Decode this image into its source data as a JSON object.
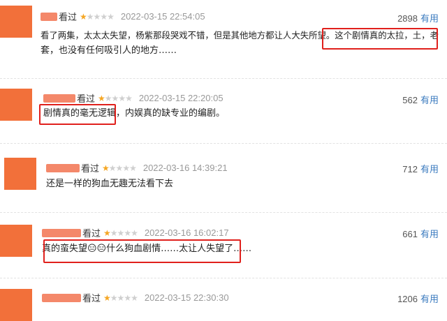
{
  "reviews": [
    {
      "verb": "看过",
      "rating": 1,
      "max_rating": 5,
      "time": "2022-03-15 22:54:05",
      "useful_count": "2898",
      "useful_label": "有用",
      "content_line1": "看了两集，太太太失望，杨紫那段哭戏不错，但是其他地方都让人大失所望。这个剧情真的太拉，土，老",
      "content_line2": "套，也没有任何吸引人的地方……"
    },
    {
      "verb": "看过",
      "rating": 1,
      "max_rating": 5,
      "time": "2022-03-15 22:20:05",
      "useful_count": "562",
      "useful_label": "有用",
      "content_line1": "剧情真的毫无逻辑，内娱真的缺专业的编剧。"
    },
    {
      "verb": "看过",
      "rating": 1,
      "max_rating": 5,
      "time": "2022-03-16 14:39:21",
      "useful_count": "712",
      "useful_label": "有用",
      "content_line1": "还是一样的狗血无趣无法看下去"
    },
    {
      "verb": "看过",
      "rating": 1,
      "max_rating": 5,
      "time": "2022-03-16 16:02:17",
      "useful_count": "661",
      "useful_label": "有用",
      "content_line1": "真的蛮失望😑😑什么狗血剧情……太让人失望了……"
    },
    {
      "verb": "看过",
      "rating": 1,
      "max_rating": 5,
      "time": "2022-03-15 22:30:30",
      "useful_count": "1206",
      "useful_label": "有用"
    }
  ],
  "colors": {
    "avatar": "#f2703a",
    "highlight_box": "#e0201c",
    "useful_link": "#3b7bbf",
    "star_on": "#f5a623",
    "star_off": "#cfcfcf"
  }
}
